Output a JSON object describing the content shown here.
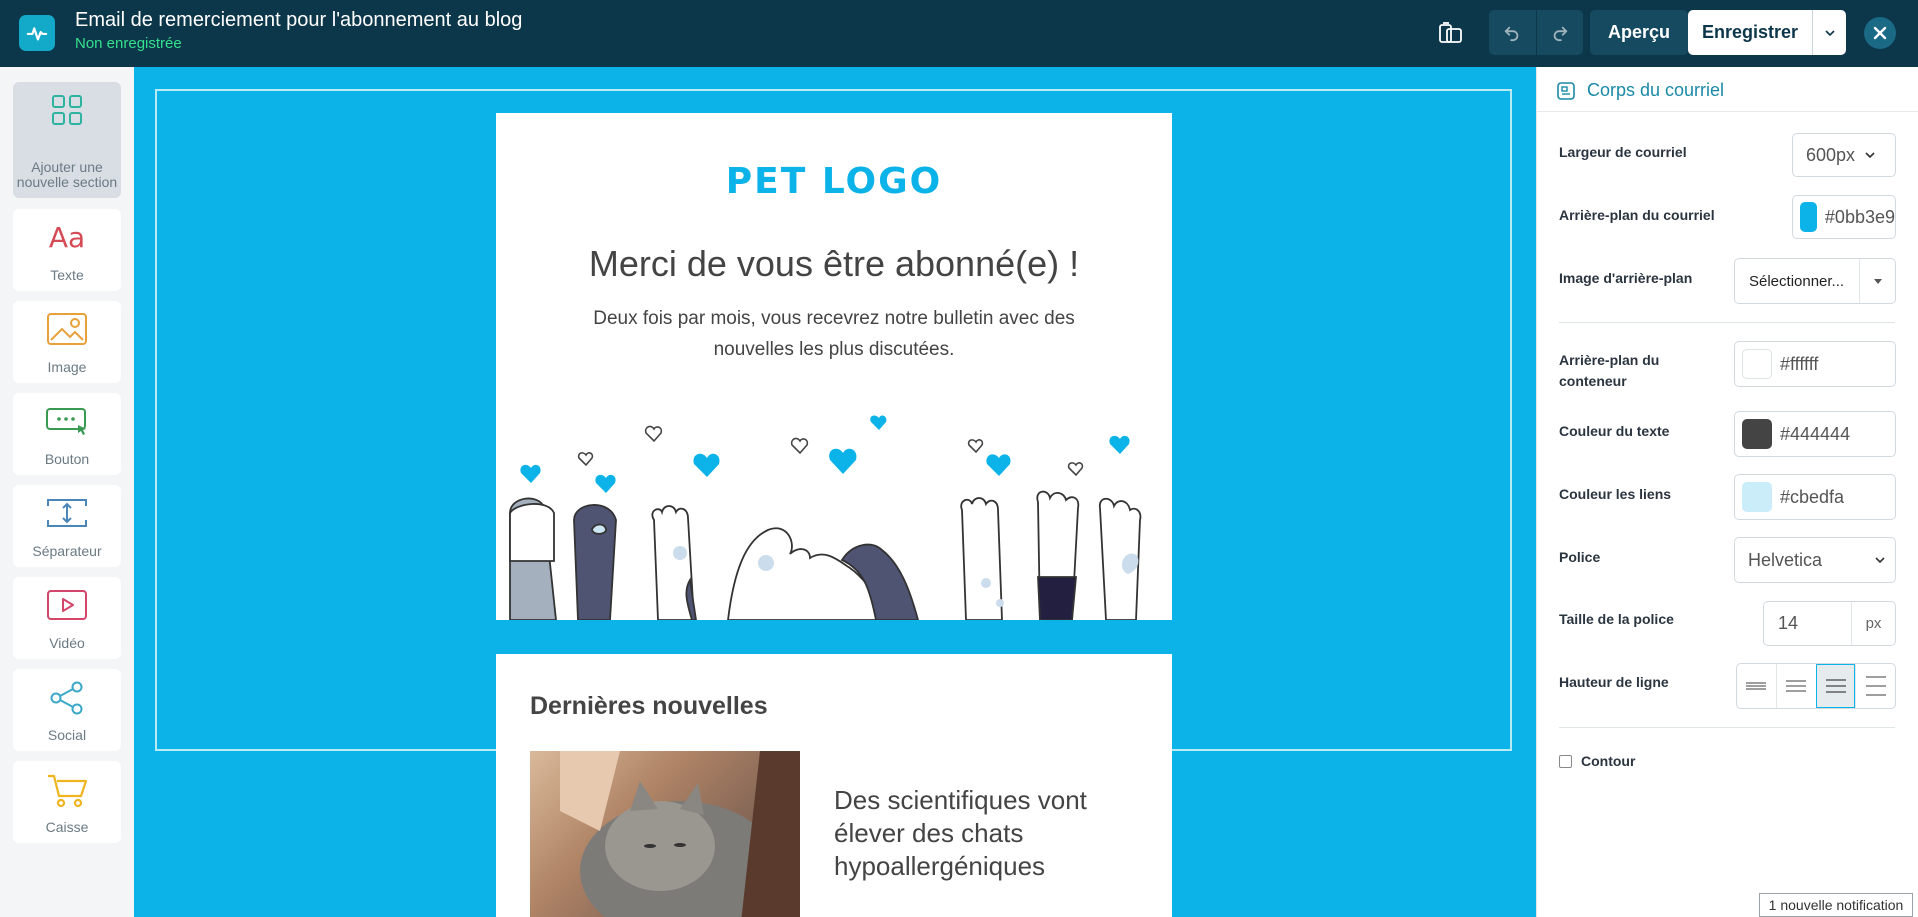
{
  "app": {
    "title": "Email de remerciement pour l'abonnement au blog",
    "status": "Non enregistrée"
  },
  "toolbar": {
    "preview_label": "Aperçu",
    "save_label": "Enregistrer"
  },
  "tools": [
    {
      "label": "Ajouter une nouvelle section",
      "icon": "grid-icon"
    },
    {
      "label": "Texte",
      "icon": "text-aa-icon"
    },
    {
      "label": "Image",
      "icon": "image-icon"
    },
    {
      "label": "Bouton",
      "icon": "button-icon"
    },
    {
      "label": "Séparateur",
      "icon": "separator-icon"
    },
    {
      "label": "Vidéo",
      "icon": "video-icon"
    },
    {
      "label": "Social",
      "icon": "share-icon"
    },
    {
      "label": "Caisse",
      "icon": "cart-icon"
    }
  ],
  "email": {
    "logo_text": "PET LOGO",
    "hero_title": "Merci de vous être abonné(e) !",
    "hero_text": "Deux fois par mois, vous recevrez notre bulletin avec des nouvelles les plus discutées.",
    "news_title": "Dernières nouvelles",
    "news_headline": "Des scientifiques vont élever des chats hypoallergéniques"
  },
  "panel": {
    "title": "Corps du courriel",
    "email_width_label": "Largeur de courriel",
    "email_width_value": "600px",
    "email_bg_label": "Arrière-plan du courriel",
    "email_bg_value": "#0bb3e9",
    "bg_image_label": "Image d'arrière-plan",
    "bg_image_value": "Sélectionner...",
    "container_bg_label": "Arrière-plan du conteneur",
    "container_bg_value": "#ffffff",
    "text_color_label": "Couleur du texte",
    "text_color_value": "#444444",
    "link_color_label": "Couleur les liens",
    "link_color_value": "#cbedfa",
    "font_label": "Police",
    "font_value": "Helvetica",
    "font_size_label": "Taille de la police",
    "font_size_value": "14",
    "font_size_unit": "px",
    "line_height_label": "Hauteur de ligne",
    "border_label": "Contour"
  },
  "notification": "1 nouvelle notification",
  "colors": {
    "topbar": "#0c3649",
    "canvas": "#0bb3e9",
    "accent": "#1a8aa7",
    "status": "#35e08e"
  }
}
